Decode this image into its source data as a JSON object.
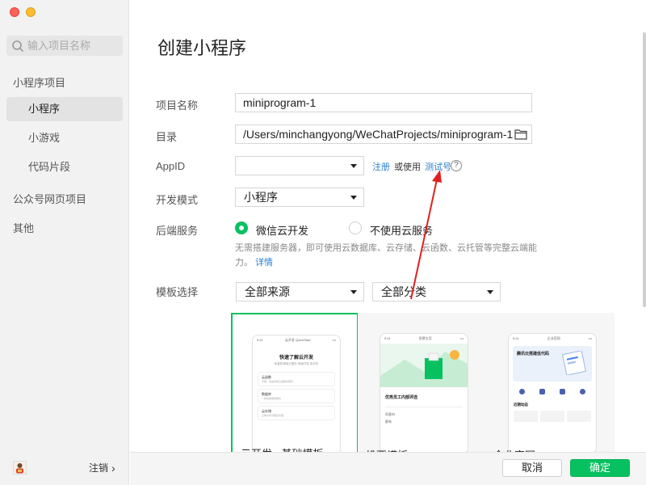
{
  "sidebar": {
    "search_placeholder": "输入项目名称",
    "sections": {
      "miniprogram_projects": "小程序项目",
      "miniprogram": "小程序",
      "minigame": "小游戏",
      "code_snippet": "代码片段",
      "official_account_web": "公众号网页项目",
      "other": "其他"
    },
    "logout_label": "注销",
    "logout_chevron": "›"
  },
  "main": {
    "title": "创建小程序",
    "project_name_label": "项目名称",
    "project_name_value": "miniprogram-1",
    "directory_label": "目录",
    "directory_value": "/Users/minchangyong/WeChatProjects/miniprogram-1",
    "appid_label": "AppID",
    "appid_value": "",
    "register_link": "注册",
    "or_use_text": "或使用",
    "test_account_link": "测试号",
    "help_glyph": "?",
    "dev_mode_label": "开发模式",
    "dev_mode_value": "小程序",
    "backend_label": "后端服务",
    "backend_options": {
      "cloud": "微信云开发",
      "no_cloud": "不使用云服务"
    },
    "backend_selected": "cloud",
    "backend_help": "无需搭建服务器，即可使用云数据库、云存储、云函数、云托管等完整云端能力。",
    "backend_detail_link": "详情",
    "template_label": "模板选择",
    "template_source_value": "全部来源",
    "template_category_value": "全部分类",
    "templates": [
      {
        "label": "云开发 - 基础模板",
        "phone_header": "云开发 QuickStart",
        "phone_title": "快速了解云开发",
        "phone_subtitle": "免鉴权调用云服务 快速开发 用手机",
        "items": [
          "云函数",
          "数据库",
          "云存储"
        ],
        "item_descs": [
          "无需，快速调用云函数和服务",
          "一体化数据库服务",
          "云端文件存储及管理"
        ]
      },
      {
        "label": "投票模板",
        "phone_header": "投票主页",
        "banner_title": "优秀员工内部评选",
        "options": [
          "同意吗",
          "都有"
        ]
      },
      {
        "label": "企业官网",
        "phone_header": "企业官网",
        "banner_title": "腾讯云搭建低代码",
        "section": "近期动态"
      }
    ],
    "status_time": "9:41"
  },
  "footer": {
    "cancel_label": "取消",
    "ok_label": "确定"
  },
  "colors": {
    "accent_green": "#07c160",
    "link_blue": "#2a7fd4",
    "arrow_red": "#e02020"
  }
}
